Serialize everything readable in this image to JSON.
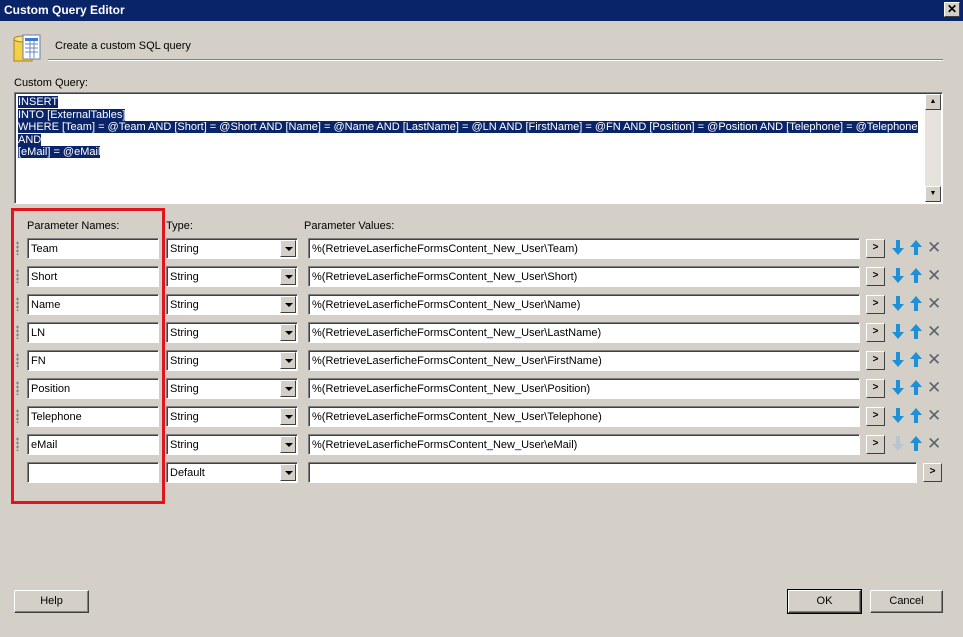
{
  "window": {
    "title": "Custom Query Editor",
    "close_glyph": "✕"
  },
  "header": {
    "icon": "database-icon",
    "text": "Create a custom SQL query"
  },
  "query": {
    "label": "Custom Query:",
    "lines": [
      "INSERT",
      "INTO [ExternalTables]",
      "WHERE [Team] = @Team AND [Short] = @Short AND [Name] = @Name AND [LastName] = @LN AND [FirstName] = @FN AND [Position] = @Position AND [Telephone] = @Telephone AND",
      "[eMail] = @eMail"
    ]
  },
  "params": {
    "headers": {
      "names": "Parameter Names:",
      "type": "Type:",
      "values": "Parameter Values:"
    },
    "rows": [
      {
        "name": "Team",
        "type": "String",
        "value": "%(RetrieveLaserficheFormsContent_New_User\\Team)"
      },
      {
        "name": "Short",
        "type": "String",
        "value": "%(RetrieveLaserficheFormsContent_New_User\\Short)"
      },
      {
        "name": "Name",
        "type": "String",
        "value": "%(RetrieveLaserficheFormsContent_New_User\\Name)"
      },
      {
        "name": "LN",
        "type": "String",
        "value": "%(RetrieveLaserficheFormsContent_New_User\\LastName)"
      },
      {
        "name": "FN",
        "type": "String",
        "value": "%(RetrieveLaserficheFormsContent_New_User\\FirstName)"
      },
      {
        "name": "Position",
        "type": "String",
        "value": "%(RetrieveLaserficheFormsContent_New_User\\Position)"
      },
      {
        "name": "Telephone",
        "type": "String",
        "value": "%(RetrieveLaserficheFormsContent_New_User\\Telephone)"
      },
      {
        "name": "eMail",
        "type": "String",
        "value": "%(RetrieveLaserficheFormsContent_New_User\\eMail)"
      }
    ],
    "new_row": {
      "name": "",
      "type": "Default",
      "value": ""
    },
    "browse_label": ">",
    "icons": {
      "down": "arrow-down-icon",
      "up": "arrow-up-icon",
      "delete": "delete-x-icon"
    }
  },
  "buttons": {
    "help": "Help",
    "ok": "OK",
    "cancel": "Cancel"
  },
  "colors": {
    "accent_blue": "#1e90d8",
    "highlight_red": "#e0151f",
    "selection": "#0a246a"
  }
}
